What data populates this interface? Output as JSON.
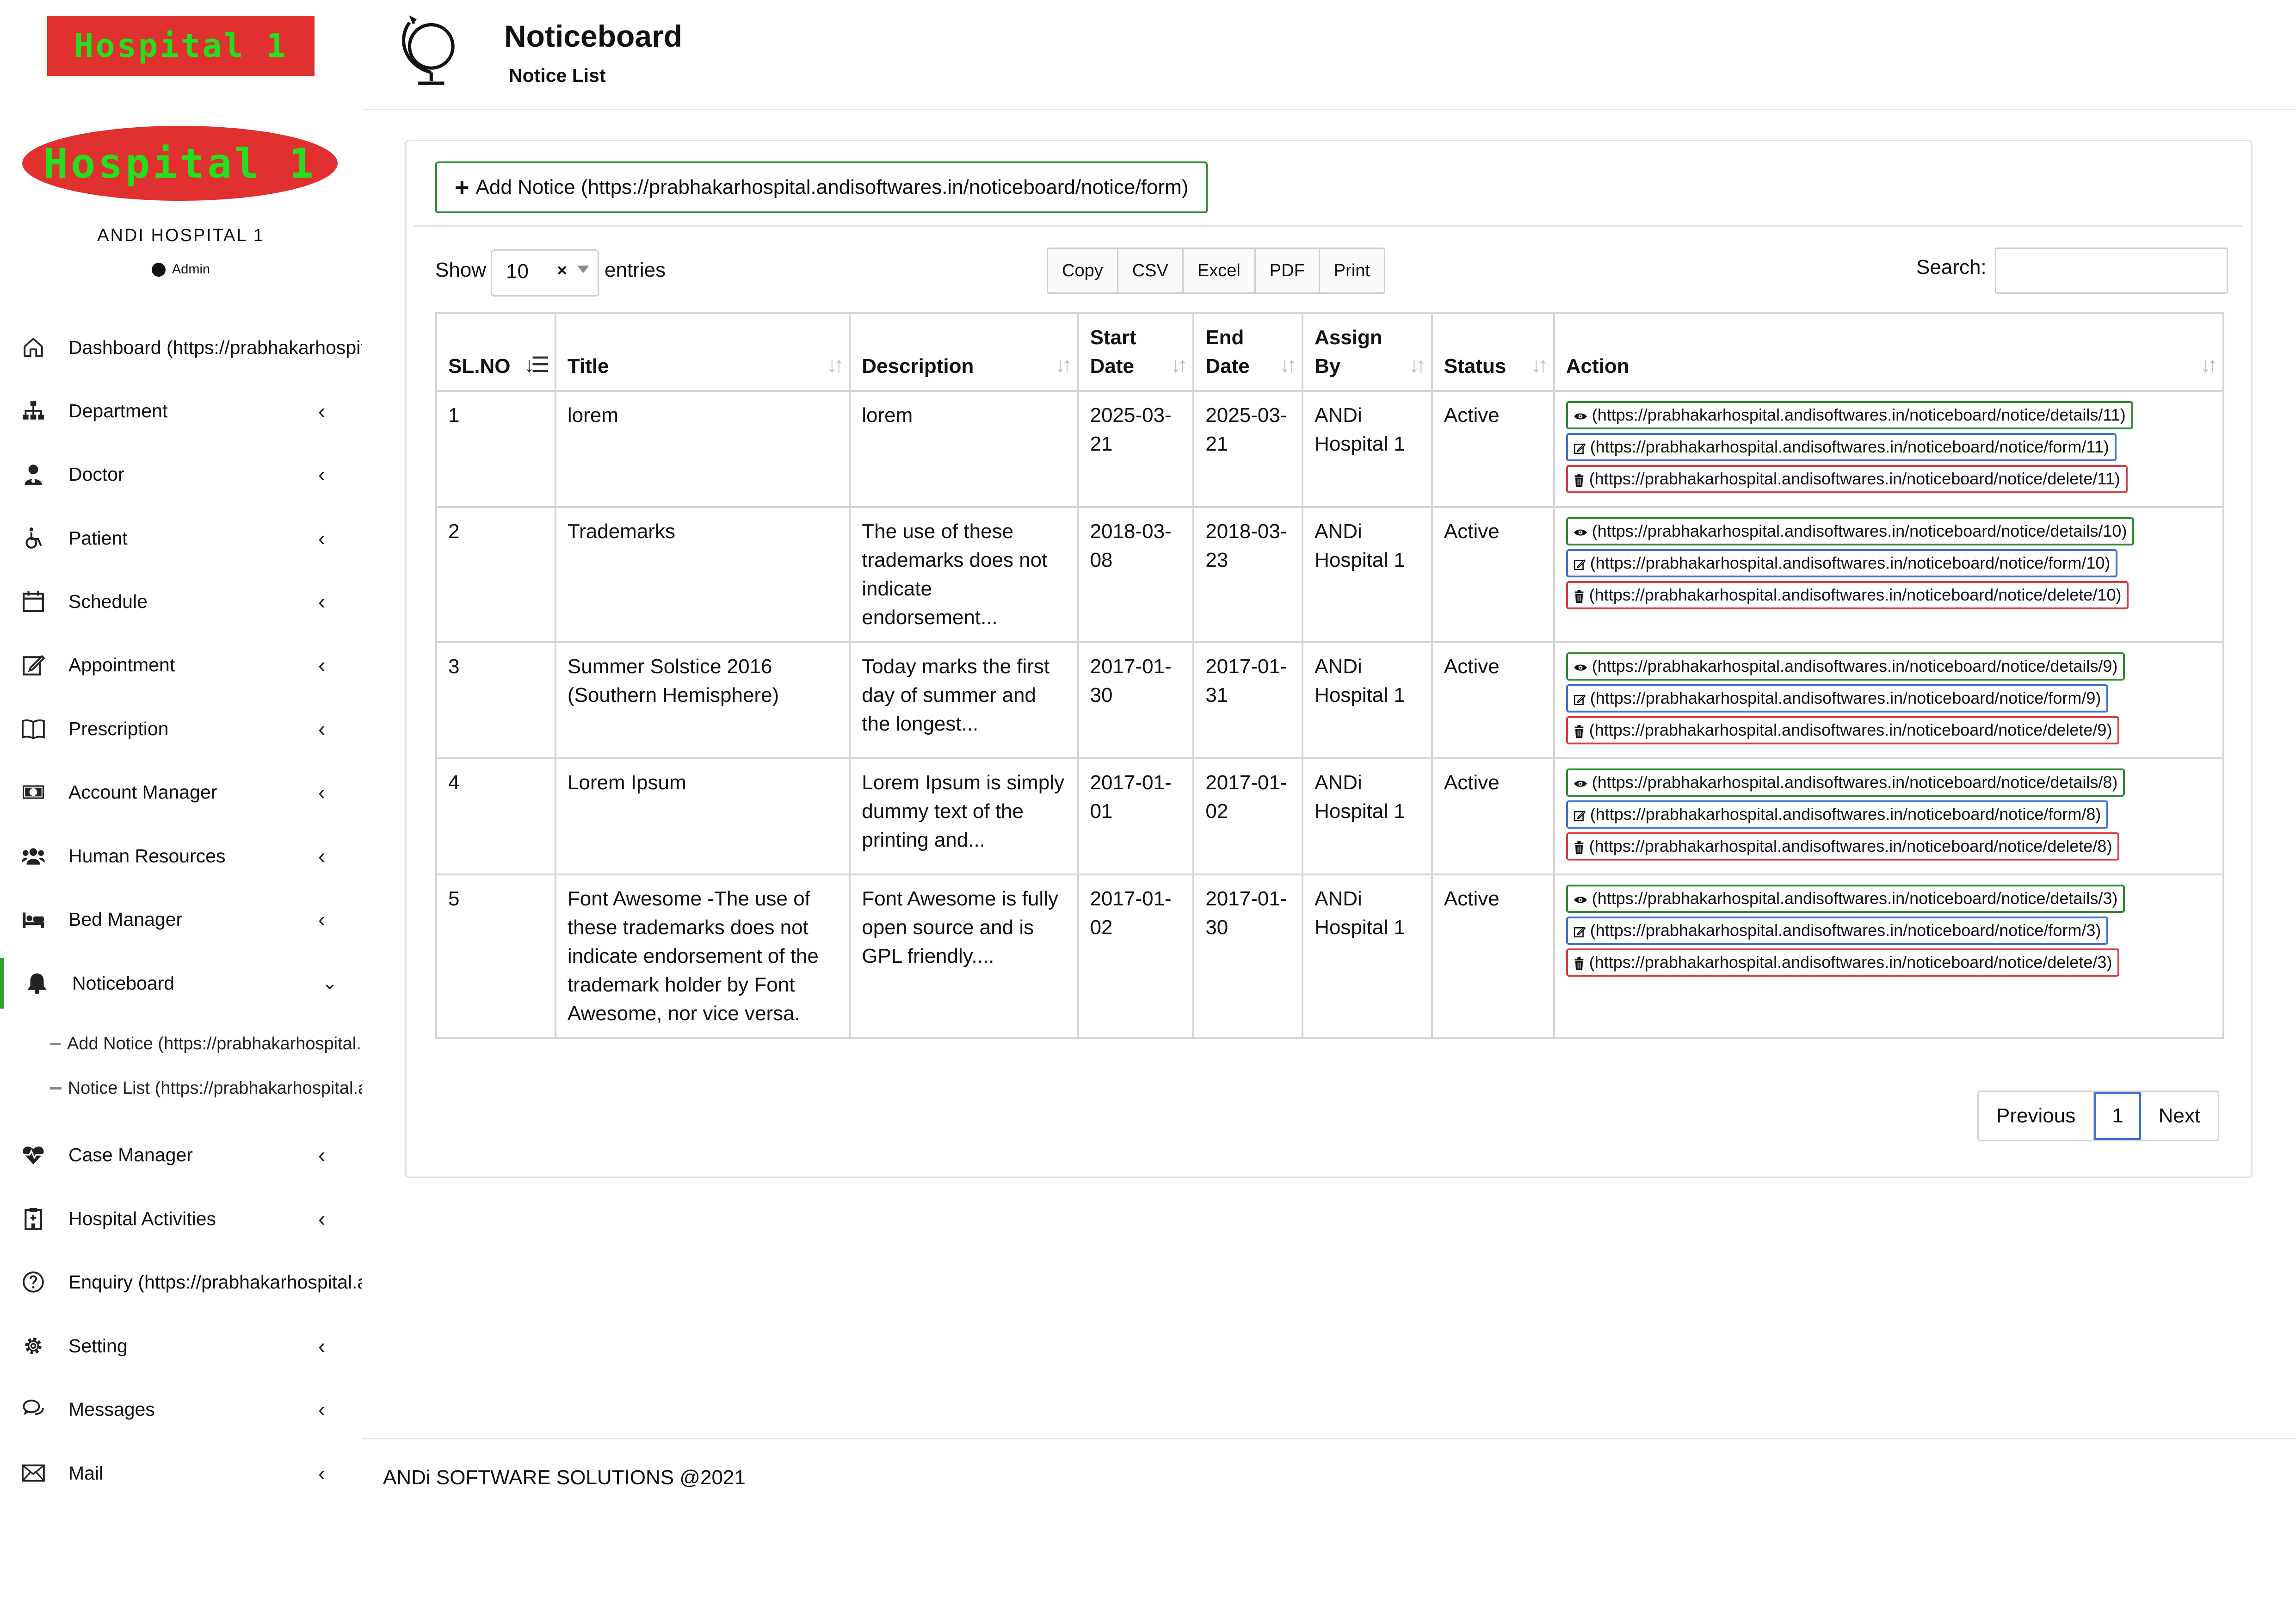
{
  "brand": {
    "logo_text": "Hospital 1",
    "logo2_text": "Hospital 1",
    "hospital_name": "ANDI HOSPITAL 1",
    "role": "Admin"
  },
  "sidebar": {
    "items": [
      {
        "label": "Dashboard (https://prabhakarhospital.andisoftwares.in/dashboard)",
        "icon": "home-icon"
      },
      {
        "label": "Department",
        "icon": "sitemap-icon"
      },
      {
        "label": "Doctor",
        "icon": "user-md-icon"
      },
      {
        "label": "Patient",
        "icon": "wheelchair-icon"
      },
      {
        "label": "Schedule",
        "icon": "calendar-icon"
      },
      {
        "label": "Appointment",
        "icon": "edit-icon"
      },
      {
        "label": "Prescription",
        "icon": "book-icon"
      },
      {
        "label": "Account Manager",
        "icon": "money-icon"
      },
      {
        "label": "Human Resources",
        "icon": "users-icon"
      },
      {
        "label": "Bed Manager",
        "icon": "bed-icon"
      },
      {
        "label": "Noticeboard",
        "icon": "bell-icon"
      },
      {
        "label": "Case Manager",
        "icon": "heartbeat-icon"
      },
      {
        "label": "Hospital Activities",
        "icon": "hospital-icon"
      },
      {
        "label": "Enquiry (https://prabhakarhospital.andisoftwares.in/enquiry)",
        "icon": "question-icon"
      },
      {
        "label": "Setting",
        "icon": "gear-icon"
      },
      {
        "label": "Messages",
        "icon": "comments-icon"
      },
      {
        "label": "Mail",
        "icon": "envelope-icon"
      }
    ],
    "noticeboard_sub": [
      {
        "label": "Add Notice (https://prabhakarhospital.andisoftwares.in/noticeboard/notice/form)"
      },
      {
        "label": "Notice List (https://prabhakarhospital.andisoftwares.in/noticeboard/notice)"
      }
    ]
  },
  "header": {
    "title": "Noticeboard",
    "subtitle": "Notice List",
    "icon": "globe-icon"
  },
  "toolbar": {
    "add_label": "Add Notice (https://prabhakarhospital.andisoftwares.in/noticeboard/notice/form)",
    "show_label": "Show",
    "show_value": "10",
    "entries_label": "entries",
    "export_buttons": [
      "Copy",
      "CSV",
      "Excel",
      "PDF",
      "Print"
    ],
    "search_label": "Search:",
    "search_value": ""
  },
  "table": {
    "headers": [
      "SL.NO",
      "Title",
      "Description",
      "Start Date",
      "End Date",
      "Assign By",
      "Status",
      "Action"
    ],
    "rows": [
      {
        "sl": "1",
        "title": "lorem",
        "desc": "lorem",
        "start": "2025-03-21",
        "end": "2025-03-21",
        "by": "ANDi Hospital 1",
        "status": "Active",
        "view": "(https://prabhakarhospital.andisoftwares.in/noticeboard/notice/details/11)",
        "edit": "(https://prabhakarhospital.andisoftwares.in/noticeboard/notice/form/11)",
        "del": "(https://prabhakarhospital.andisoftwares.in/noticeboard/notice/delete/11)"
      },
      {
        "sl": "2",
        "title": "Trademarks",
        "desc": "The use of these trademarks does not indicate endorsement...",
        "start": "2018-03-08",
        "end": "2018-03-23",
        "by": "ANDi Hospital 1",
        "status": "Active",
        "view": "(https://prabhakarhospital.andisoftwares.in/noticeboard/notice/details/10)",
        "edit": "(https://prabhakarhospital.andisoftwares.in/noticeboard/notice/form/10)",
        "del": "(https://prabhakarhospital.andisoftwares.in/noticeboard/notice/delete/10)"
      },
      {
        "sl": "3",
        "title": "Summer Solstice 2016 (Southern Hemisphere)",
        "desc": "Today marks the first day of summer and the longest...",
        "start": "2017-01-30",
        "end": "2017-01-31",
        "by": "ANDi Hospital 1",
        "status": "Active",
        "view": "(https://prabhakarhospital.andisoftwares.in/noticeboard/notice/details/9)",
        "edit": "(https://prabhakarhospital.andisoftwares.in/noticeboard/notice/form/9)",
        "del": "(https://prabhakarhospital.andisoftwares.in/noticeboard/notice/delete/9)"
      },
      {
        "sl": "4",
        "title": "Lorem Ipsum",
        "desc": "Lorem Ipsum is simply dummy text of the printing and...",
        "start": "2017-01-01",
        "end": "2017-01-02",
        "by": "ANDi Hospital 1",
        "status": "Active",
        "view": "(https://prabhakarhospital.andisoftwares.in/noticeboard/notice/details/8)",
        "edit": "(https://prabhakarhospital.andisoftwares.in/noticeboard/notice/form/8)",
        "del": "(https://prabhakarhospital.andisoftwares.in/noticeboard/notice/delete/8)"
      },
      {
        "sl": "5",
        "title": "Font Awesome -The use of these trademarks does not indicate endorsement of the trademark holder by Font Awesome, nor vice versa.",
        "desc": "Font Awesome is fully open source and is GPL friendly....",
        "start": "2017-01-02",
        "end": "2017-01-30",
        "by": "ANDi Hospital 1",
        "status": "Active",
        "view": "(https://prabhakarhospital.andisoftwares.in/noticeboard/notice/details/3)",
        "edit": "(https://prabhakarhospital.andisoftwares.in/noticeboard/notice/form/3)",
        "del": "(https://prabhakarhospital.andisoftwares.in/noticeboard/notice/delete/3)"
      }
    ]
  },
  "pagination": {
    "previous": "Previous",
    "current": "1",
    "next": "Next"
  },
  "footer": {
    "text": "ANDi SOFTWARE SOLUTIONS @2021"
  },
  "colors": {
    "brand_red": "#e03030",
    "brand_green": "#22e01e",
    "active_green": "#2e9e2e",
    "view_border": "#2e8a2e",
    "edit_border": "#3d6fd4",
    "delete_border": "#d43d3d"
  }
}
